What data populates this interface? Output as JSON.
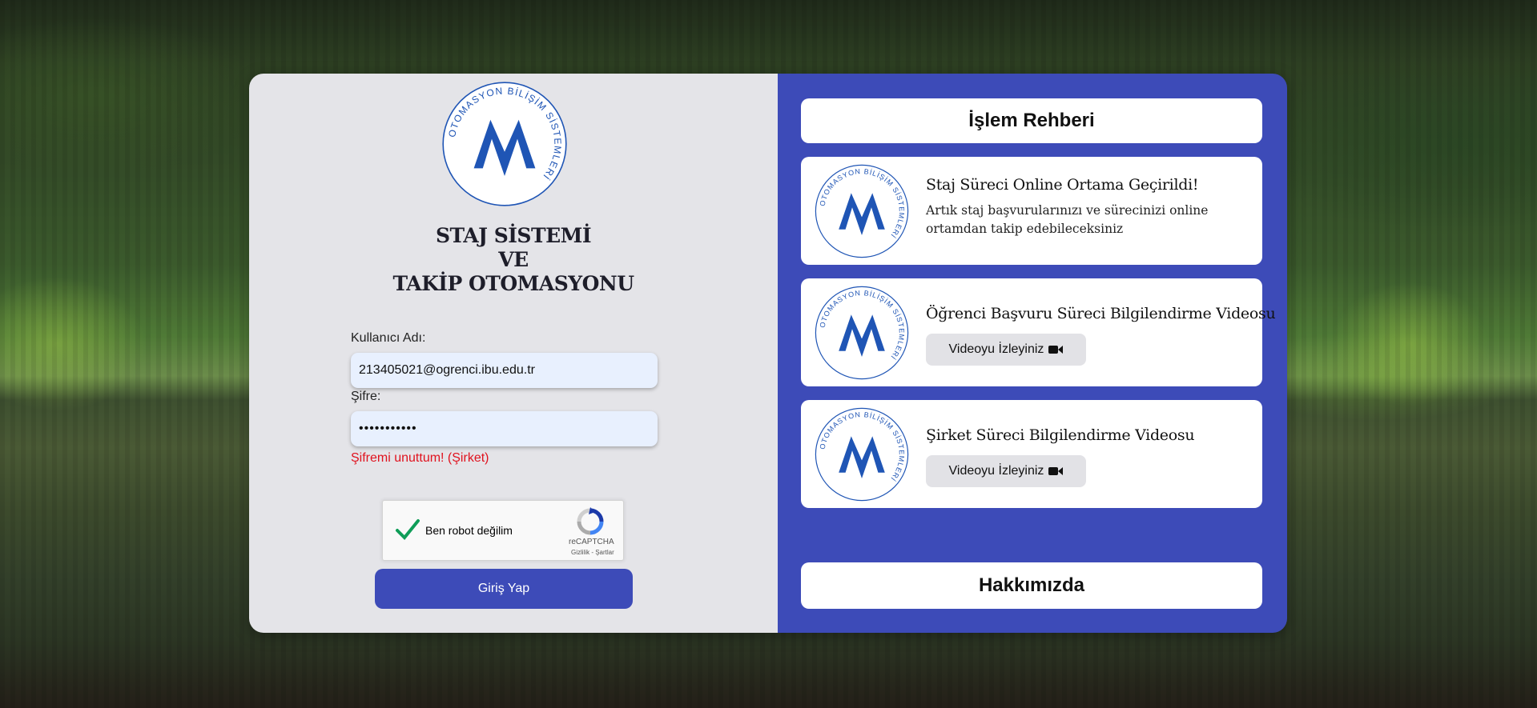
{
  "app": {
    "logo": {
      "ring_text": "OTOMASYON BİLİŞİM SİSTEMLERİ",
      "brand_color": "#1f55b5"
    },
    "title_lines": [
      "STAJ SİSTEMİ",
      "VE",
      "TAKİP OTOMASYONU"
    ]
  },
  "login": {
    "username_label": "Kullanıcı Adı:",
    "username_value": "213405021@ogrenci.ibu.edu.tr",
    "password_label": "Şifre:",
    "password_value": "•••••••••••",
    "forgot_link": "Şifremi unuttum! (Şirket)",
    "captcha": {
      "label": "Ben robot değilim",
      "brand": "reCAPTCHA",
      "terms": "Gizlilik - Şartlar",
      "checked": true
    },
    "submit_label": "Giriş Yap"
  },
  "guide": {
    "header": "İşlem Rehberi",
    "items": [
      {
        "title": "Staj Süreci Online Ortama Geçirildi!",
        "description": "Artık staj başvurularınızı ve sürecinizi online ortamdan takip edebileceksiniz"
      },
      {
        "title": "Öğrenci Başvuru Süreci Bilgilendirme Videosu",
        "button_label": "Videoyu İzleyiniz",
        "button_icon": "video-camera-icon"
      },
      {
        "title": "Şirket Süreci Bilgilendirme Videosu",
        "button_label": "Videoyu İzleyiniz",
        "button_icon": "video-camera-icon"
      }
    ],
    "about_label": "Hakkımızda"
  },
  "colors": {
    "accent": "#3d4bb8",
    "panel_left": "#e4e4e8",
    "error": "#e0121e",
    "input_bg": "#e8f0fe"
  }
}
